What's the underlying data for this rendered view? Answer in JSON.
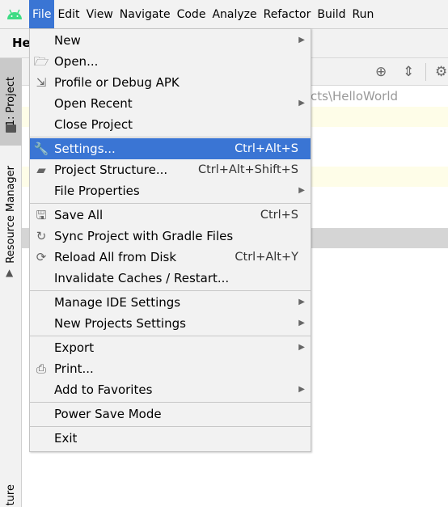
{
  "menubar": {
    "items": [
      {
        "label": "File",
        "mn": 0,
        "active": true
      },
      {
        "label": "Edit",
        "mn": 0
      },
      {
        "label": "View",
        "mn": 0
      },
      {
        "label": "Navigate",
        "mn": 0
      },
      {
        "label": "Code",
        "mn": 0
      },
      {
        "label": "Analyze",
        "mn": 5
      },
      {
        "label": "Refactor",
        "mn": 0
      },
      {
        "label": "Build",
        "mn": 0
      },
      {
        "label": "Run",
        "mn": 1
      }
    ],
    "accent": "#3a75d4"
  },
  "navbar": {
    "title": "He"
  },
  "sidebar": {
    "tabs": [
      {
        "label": "1: Project"
      },
      {
        "label": "Resource Manager"
      },
      {
        "label": "ture"
      }
    ]
  },
  "editor": {
    "path_fragment": "cts\\HelloWorld"
  },
  "file_menu": {
    "items": [
      {
        "label": "New",
        "mn": 0,
        "submenu": true
      },
      {
        "label": "Open...",
        "icon": "folder-open-icon"
      },
      {
        "label": "Profile or Debug APK",
        "icon": "profile-apk-icon"
      },
      {
        "label": "Open Recent",
        "mn": 5,
        "submenu": true
      },
      {
        "label": "Close Project"
      },
      {
        "separator": true
      },
      {
        "label": "Settings...",
        "mn": 2,
        "icon": "wrench-icon",
        "shortcut": "Ctrl+Alt+S",
        "highlighted": true
      },
      {
        "label": "Project Structure...",
        "icon": "project-structure-icon",
        "shortcut": "Ctrl+Alt+Shift+S"
      },
      {
        "label": "File Properties",
        "submenu": true
      },
      {
        "separator": true
      },
      {
        "label": "Save All",
        "mn": 0,
        "icon": "save-icon",
        "shortcut": "Ctrl+S"
      },
      {
        "label": "Sync Project with Gradle Files",
        "mn": 18,
        "icon": "gradle-sync-icon"
      },
      {
        "label": "Reload All from Disk",
        "icon": "reload-icon",
        "shortcut": "Ctrl+Alt+Y"
      },
      {
        "label": "Invalidate Caches / Restart..."
      },
      {
        "separator": true
      },
      {
        "label": "Manage IDE Settings",
        "submenu": true
      },
      {
        "label": "New Projects Settings",
        "submenu": true
      },
      {
        "separator": true
      },
      {
        "label": "Export",
        "submenu": true
      },
      {
        "label": "Print...",
        "mn": 0,
        "icon": "printer-icon"
      },
      {
        "label": "Add to Favorites",
        "mn": 8,
        "submenu": true
      },
      {
        "separator": true
      },
      {
        "label": "Power Save Mode"
      },
      {
        "separator": true
      },
      {
        "label": "Exit",
        "mn": 1
      }
    ]
  }
}
